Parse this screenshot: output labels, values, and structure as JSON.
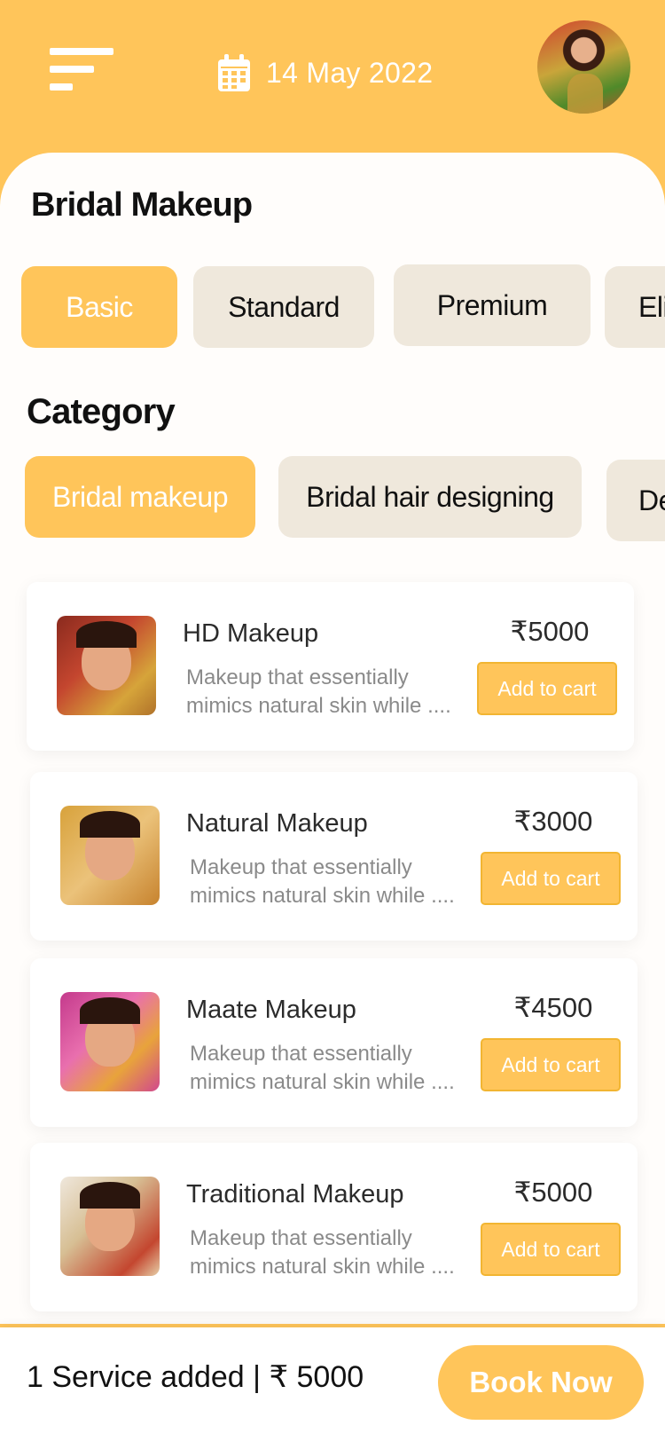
{
  "header": {
    "date": "14 May 2022",
    "calendar_icon": "calendar-icon",
    "menu_icon": "menu-icon"
  },
  "page_title": "Bridal Makeup",
  "packages": [
    {
      "label": "Basic",
      "active": true
    },
    {
      "label": "Standard",
      "active": false
    },
    {
      "label": "Premium",
      "active": false
    },
    {
      "label": "Eli",
      "active": false
    }
  ],
  "category_title": "Category",
  "categories": [
    {
      "label": "Bridal makeup",
      "active": true
    },
    {
      "label": "Bridal hair designing",
      "active": false
    },
    {
      "label": "De",
      "active": false
    }
  ],
  "services": [
    {
      "title": "HD Makeup",
      "desc_line1": "Makeup that essentially",
      "desc_line2": "mimics natural skin while ....",
      "price": "₹5000",
      "button": "Add to cart"
    },
    {
      "title": "Natural Makeup",
      "desc_line1": "Makeup that essentially",
      "desc_line2": "mimics natural skin while ....",
      "price": "₹3000",
      "button": "Add to cart"
    },
    {
      "title": "Maate Makeup",
      "desc_line1": "Makeup that essentially",
      "desc_line2": "mimics natural skin while ....",
      "price": "₹4500",
      "button": "Add to cart"
    },
    {
      "title": "Traditional Makeup",
      "desc_line1": "Makeup that essentially",
      "desc_line2": "mimics natural skin while ....",
      "price": "₹5000",
      "button": "Add to cart"
    }
  ],
  "footer": {
    "summary": "1 Service added | ₹ 5000",
    "book_label": "Book Now"
  },
  "colors": {
    "accent": "#ffc55a",
    "chip_inactive": "#efe8dc"
  }
}
